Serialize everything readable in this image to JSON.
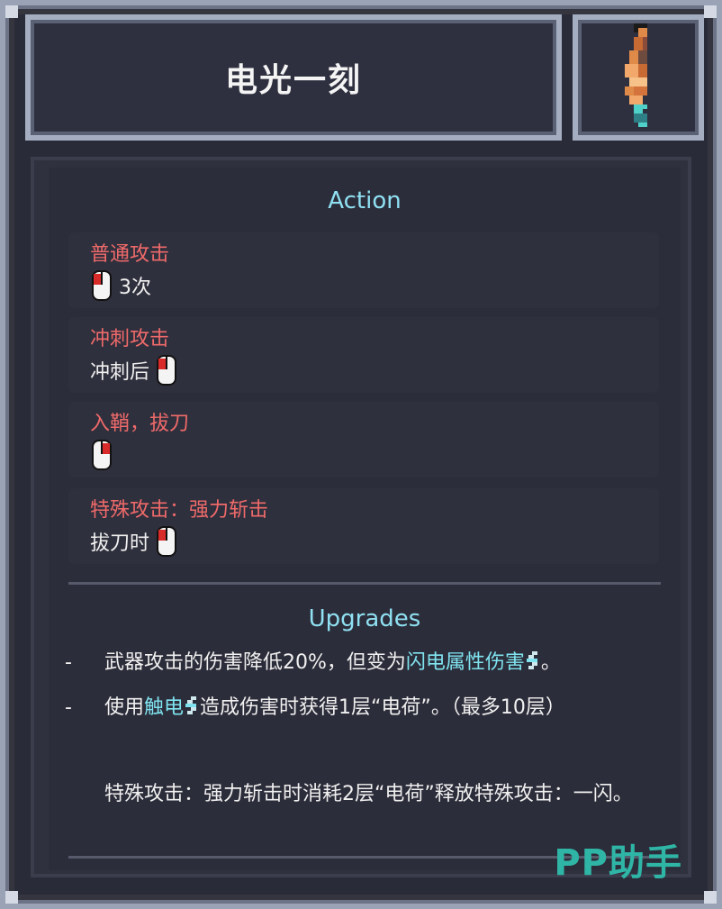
{
  "header": {
    "title": "电光一刻"
  },
  "action": {
    "heading": "Action",
    "items": [
      {
        "label": "普通攻击",
        "prefix": "",
        "suffix": "3次",
        "mouse": "left-click"
      },
      {
        "label": "冲刺攻击",
        "prefix": "冲刺后",
        "suffix": "",
        "mouse": "left-click"
      },
      {
        "label": "入鞘，拔刀",
        "prefix": "",
        "suffix": "",
        "mouse": "right-click"
      },
      {
        "label": "特殊攻击：强力斩击",
        "prefix": "拔刀时",
        "suffix": "",
        "mouse": "left-click"
      }
    ]
  },
  "upgrades": {
    "heading": "Upgrades",
    "items": [
      {
        "dash": "-",
        "text_a": "武器攻击的伤害降低20%，但变为",
        "highlight": "闪电属性伤害",
        "text_b": "。"
      },
      {
        "dash": "-",
        "text_a": "使用",
        "highlight": "触电",
        "text_b": "造成伤害时获得1层“电荷”。（最多10层）"
      },
      {
        "dash": "",
        "text_a": "特殊攻击：强力斩击时消耗2层“电荷”释放特殊攻击：一闪。",
        "highlight": "",
        "text_b": ""
      }
    ]
  },
  "watermark": "PP助手",
  "colors": {
    "accent_cyan": "#8fe0f2",
    "label_red": "#ef6a6a",
    "frame": "#a5aec0",
    "panel_bg": "#2c2d3a"
  },
  "icons": {
    "weapon": "katana-weapon-icon",
    "mouse": "mouse-click-icon",
    "bolt": "lightning-bolt-icon"
  }
}
